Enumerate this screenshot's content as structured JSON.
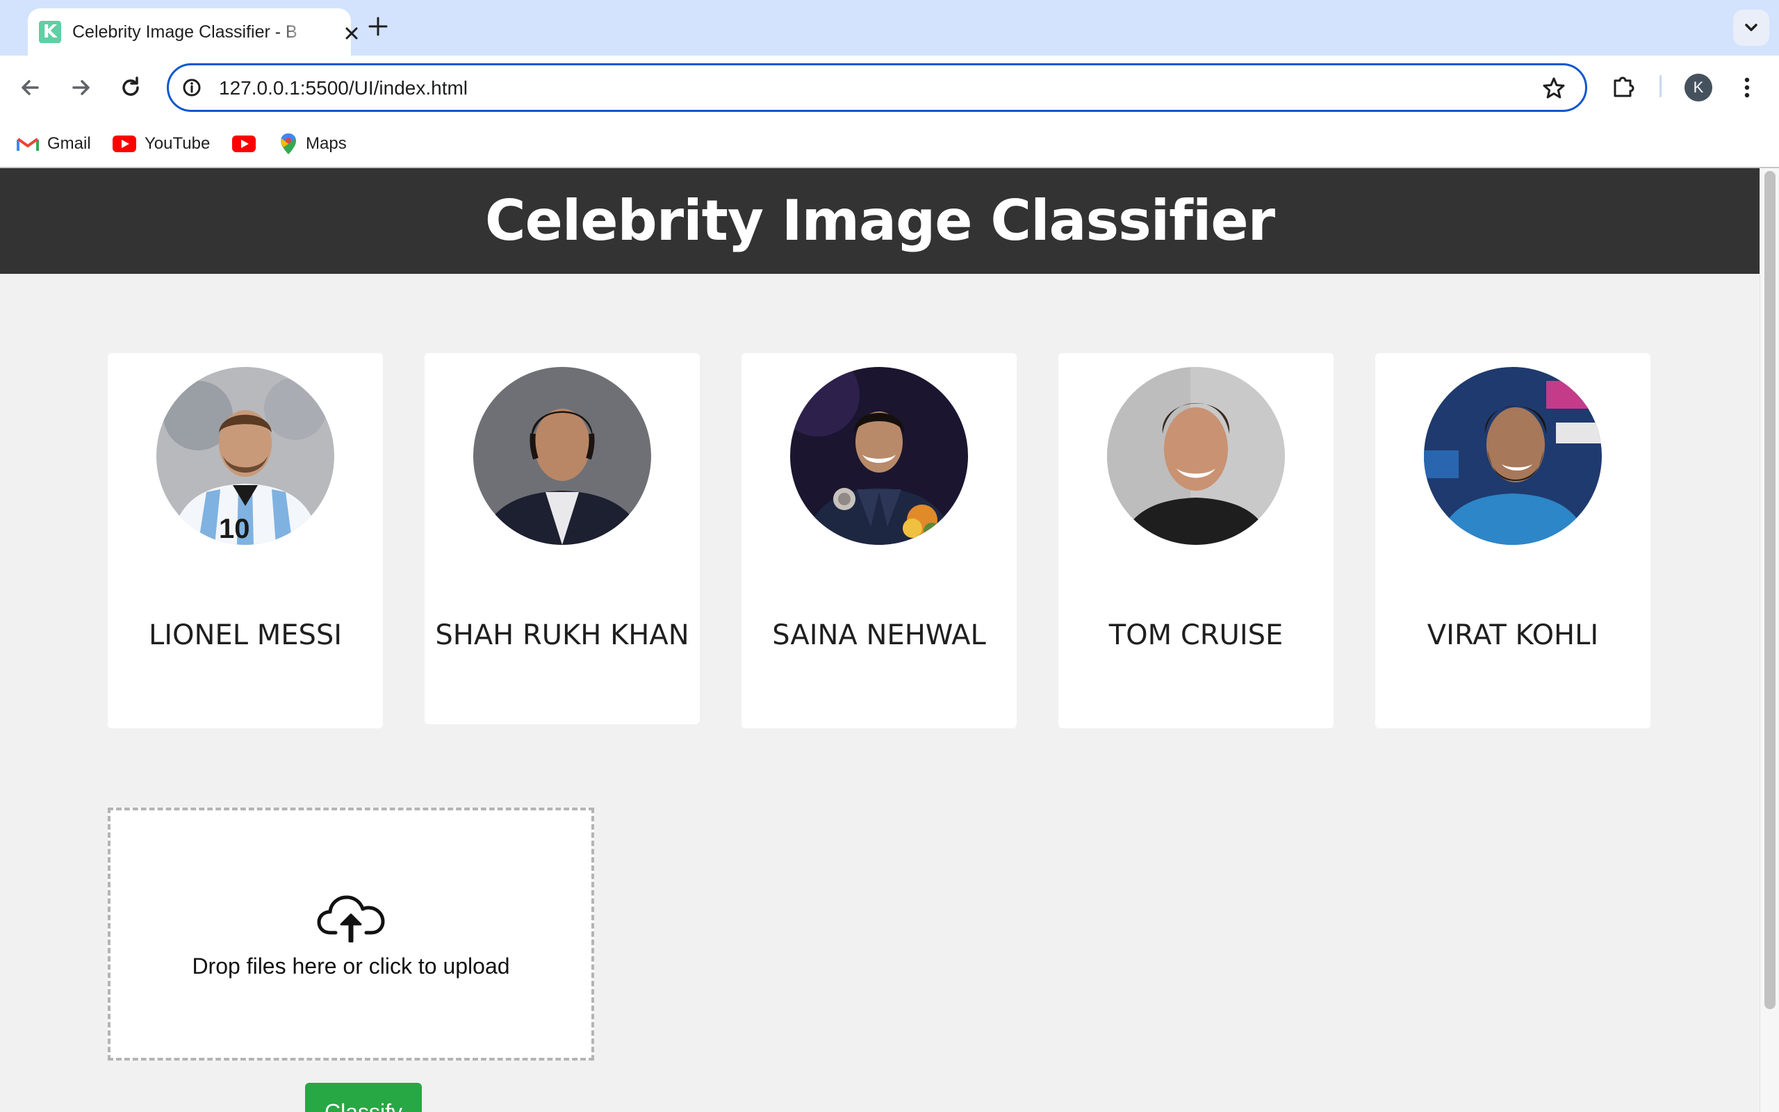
{
  "browser": {
    "tab_title": "Celebrity Image Classifier - B",
    "tab_favicon_letter": "K",
    "url": "127.0.0.1:5500/UI/index.html",
    "profile_initial": "K",
    "bookmarks": [
      {
        "label": "Gmail",
        "icon": "gmail-icon"
      },
      {
        "label": "YouTube",
        "icon": "youtube-icon"
      },
      {
        "label": "",
        "icon": "youtube-icon"
      },
      {
        "label": "Maps",
        "icon": "maps-icon"
      }
    ]
  },
  "page": {
    "title": "Celebrity Image Classifier",
    "celebrities": [
      {
        "name": "LIONEL MESSI",
        "photo": "messi-photo"
      },
      {
        "name": "SHAH RUKH KHAN",
        "photo": "shah-rukh-khan-photo"
      },
      {
        "name": "SAINA NEHWAL",
        "photo": "saina-nehwal-photo"
      },
      {
        "name": "TOM CRUISE",
        "photo": "tom-cruise-photo"
      },
      {
        "name": "VIRAT KOHLI",
        "photo": "virat-kohli-photo"
      }
    ],
    "upload": {
      "text": "Drop files here or click to upload",
      "icon": "cloud-upload-icon"
    },
    "classify_label": "Classify"
  },
  "colors": {
    "header_bg": "#333333",
    "page_bg": "#f1f1f1",
    "button_green": "#28a745",
    "tabstrip_bg": "#d3e3fd",
    "omnibox_border": "#0b57d0"
  }
}
